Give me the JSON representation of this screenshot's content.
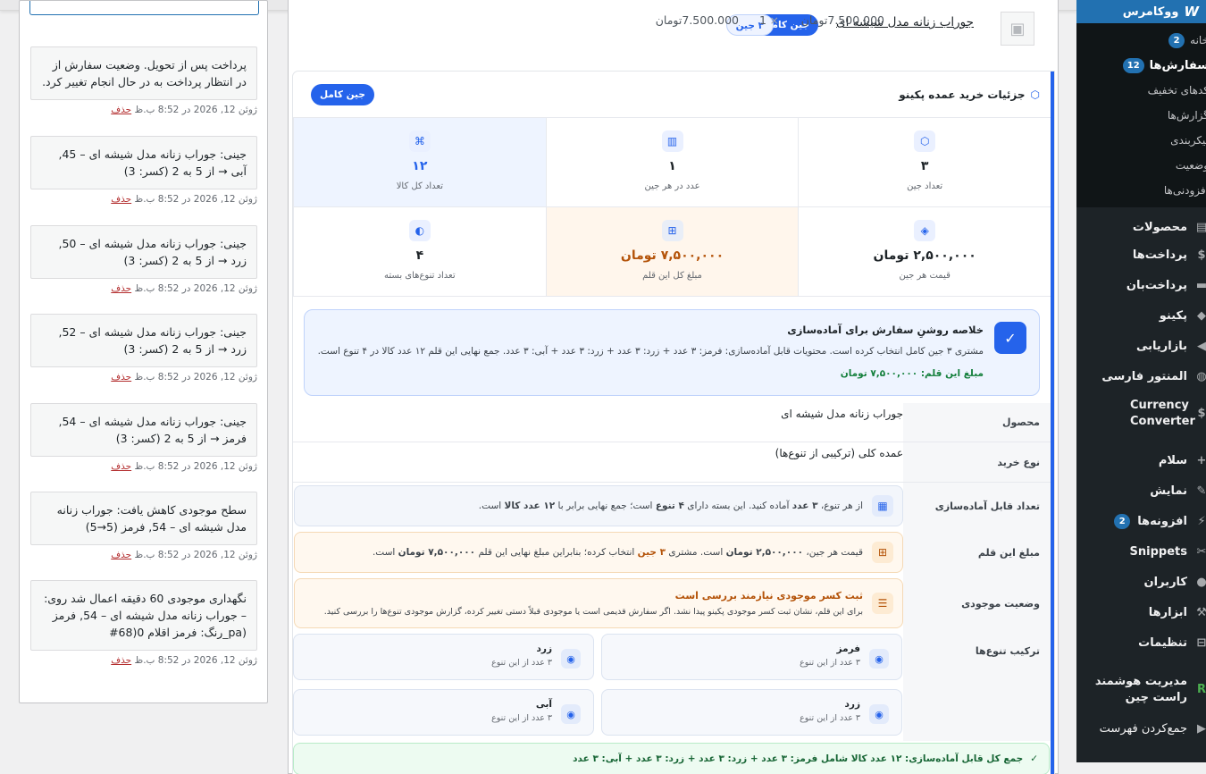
{
  "admin_menu": {
    "woocommerce": "ووکامرس",
    "sub_items": [
      {
        "label": "خانه",
        "count": "2"
      },
      {
        "label": "سفارش‌ها",
        "count": "12"
      },
      {
        "label": "کدهای تخفیف"
      },
      {
        "label": "گزارش‌ها"
      },
      {
        "label": "پیکربندی"
      },
      {
        "label": "وضعیت"
      },
      {
        "label": "افزودنی‌ها"
      }
    ],
    "main_items": [
      {
        "label": "محصولات"
      },
      {
        "label": "پرداخت‌ها"
      },
      {
        "label": "پرداخت‌بان"
      },
      {
        "label": "پکینو"
      },
      {
        "label": "بازاریابی"
      },
      {
        "label": "المنتور فارسی"
      },
      {
        "label": "Currency Converter"
      },
      {
        "label": "سلام"
      },
      {
        "label": "نمایش"
      },
      {
        "label": "افزونه‌ها",
        "count": "2"
      },
      {
        "label": "Snippets"
      },
      {
        "label": "کاربران"
      },
      {
        "label": "ابزارها"
      },
      {
        "label": "تنظیمات"
      },
      {
        "label": "مدیریت هوشمند راست چین"
      },
      {
        "label": "جمع‌کردن فهرست"
      }
    ]
  },
  "notes": [
    {
      "text": "پرداخت پس از تحویل. وضعیت سفارش از در انتظار پرداخت به در حال انجام تغییر کرد.",
      "date": "ژوئن 12, 2026 در 8:52 ب.ظ",
      "delete": "حذف"
    },
    {
      "text": "جینی: جوراب زنانه مدل شیشه ای – 45, آبی → از 5 به 2 (کسر: 3)",
      "date": "ژوئن 12, 2026 در 8:52 ب.ظ",
      "delete": "حذف"
    },
    {
      "text": "جینی: جوراب زنانه مدل شیشه ای – 50, زرد → از 5 به 2 (کسر: 3)",
      "date": "ژوئن 12, 2026 در 8:52 ب.ظ",
      "delete": "حذف"
    },
    {
      "text": "جینی: جوراب زنانه مدل شیشه ای – 52, زرد → از 5 به 2 (کسر: 3)",
      "date": "ژوئن 12, 2026 در 8:52 ب.ظ",
      "delete": "حذف"
    },
    {
      "text": "جینی: جوراب زنانه مدل شیشه ای – 54, فرمز → از 5 به 2 (کسر: 3)",
      "date": "ژوئن 12, 2026 در 8:52 ب.ظ",
      "delete": "حذف"
    },
    {
      "text": "سطح موجودی کاهش یافت: جوراب زنانه مدل شیشه ای – 54, فرمز (5→5)",
      "date": "ژوئن 12, 2026 در 8:52 ب.ظ",
      "delete": "حذف"
    },
    {
      "text": "نگهداری موجودی 60 دقیقه اعمال شد روی: – جوراب زنانه مدل شیشه ای – 54, فرمز (pa_رنگ: فرمز اقلام 0(68#",
      "date": "ژوئن 12, 2026 در 8:52 ب.ظ",
      "delete": "حذف"
    }
  ],
  "item": {
    "name": "جوراب زنانه مدل شیشه ای",
    "badge_full": "جین کامل",
    "badge_count": "۳ جین",
    "unit_price": "7.500.000تومان",
    "times": "×",
    "qty": "1",
    "line_total": "7.500.000تومان"
  },
  "pack": {
    "title": "جزئیات خرید عمده پکینو",
    "badge": "جین کامل",
    "stats": [
      {
        "icon": "box-icon",
        "glyph": "⬡",
        "value": "۳",
        "label": "تعداد جین"
      },
      {
        "icon": "columns-icon",
        "glyph": "▥",
        "value": "۱",
        "label": "عدد در هر جین"
      },
      {
        "icon": "command-icon",
        "glyph": "⌘",
        "value": "۱۲",
        "label": "تعداد کل کالا"
      },
      {
        "icon": "tag-icon",
        "glyph": "◈",
        "value": "۲,۵۰۰,۰۰۰ تومان",
        "label": "قیمت هر جین"
      },
      {
        "icon": "calculator-icon",
        "glyph": "⊞",
        "value": "۷,۵۰۰,۰۰۰ تومان",
        "label": "مبلغ کل این قلم"
      },
      {
        "icon": "palette-icon",
        "glyph": "◐",
        "value": "۴",
        "label": "تعداد تنوع‌های بسته"
      }
    ],
    "summary": {
      "title": "خلاصه روشنِ سفارش برای آماده‌سازی",
      "text": "مشتری ۳ جین کامل انتخاب کرده است. محتویات قابل آماده‌سازی: فرمز: ۳ عدد + زرد: ۳ عدد + زرد: ۳ عدد + آبی: ۳ عدد. جمع نهایی این قلم ۱۲ عدد کالا در ۴ تنوع است.",
      "amount": "مبلغ این قلم: ۷,۵۰۰,۰۰۰ تومان"
    },
    "meta": {
      "product_key": "محصول",
      "product_val": "جوراب زنانه مدل شیشه ای",
      "type_key": "نوع خرید",
      "type_val": "عمده کلی (ترکیبی از تنوع‌ها)",
      "prep_key": "تعداد قابل آماده‌سازی",
      "prep_text_a": "از هر تنوع،",
      "prep_b1": "۳ عدد",
      "prep_text_b": "آماده کنید. این بسته دارای",
      "prep_b2": "۴ تنوع",
      "prep_text_c": "است؛ جمع نهایی برابر با",
      "prep_b3": "۱۲ عدد کالا",
      "prep_text_d": "است.",
      "amount_key": "مبلغ این قلم",
      "amount_text_a": "قیمت هر جین،",
      "amount_b1": "۲,۵۰۰,۰۰۰ تومان",
      "amount_text_b": "است. مشتری",
      "amount_b2": "۳ جین",
      "amount_text_c": "انتخاب کرده؛ بنابراین مبلغ نهایی این قلم",
      "amount_b3": "۷,۵۰۰,۰۰۰ تومان",
      "amount_text_d": "است.",
      "stock_key": "وضعیت موجودی",
      "stock_title": "ثبت کسر موجودی نیازمند بررسی است",
      "stock_sub": "برای این قلم، نشان ثبت کسر موجودی پکینو پیدا نشد. اگر سفارش قدیمی است یا موجودی قبلاً دستی تغییر کرده، گزارش موجودی تنوع‌ها را بررسی کنید.",
      "variants_key": "ترکیب تنوع‌ها"
    },
    "variants": [
      {
        "name": "فرمز",
        "sub": "۳ عدد از این تنوع"
      },
      {
        "name": "زرد",
        "sub": "۳ عدد از این تنوع"
      },
      {
        "name": "زرد",
        "sub": "۳ عدد از این تنوع"
      },
      {
        "name": "آبی",
        "sub": "۳ عدد از این تنوع"
      }
    ],
    "total": "جمع کل قابل آماده‌سازی: ۱۲ عدد کالا شامل فرمز: ۳ عدد + زرد: ۳ عدد + زرد: ۳ عدد + آبی: ۳ عدد"
  },
  "colors": {
    "accent": "#2563eb",
    "wp_blue": "#2271b1",
    "success": "#15803d",
    "warning": "#b45309"
  }
}
